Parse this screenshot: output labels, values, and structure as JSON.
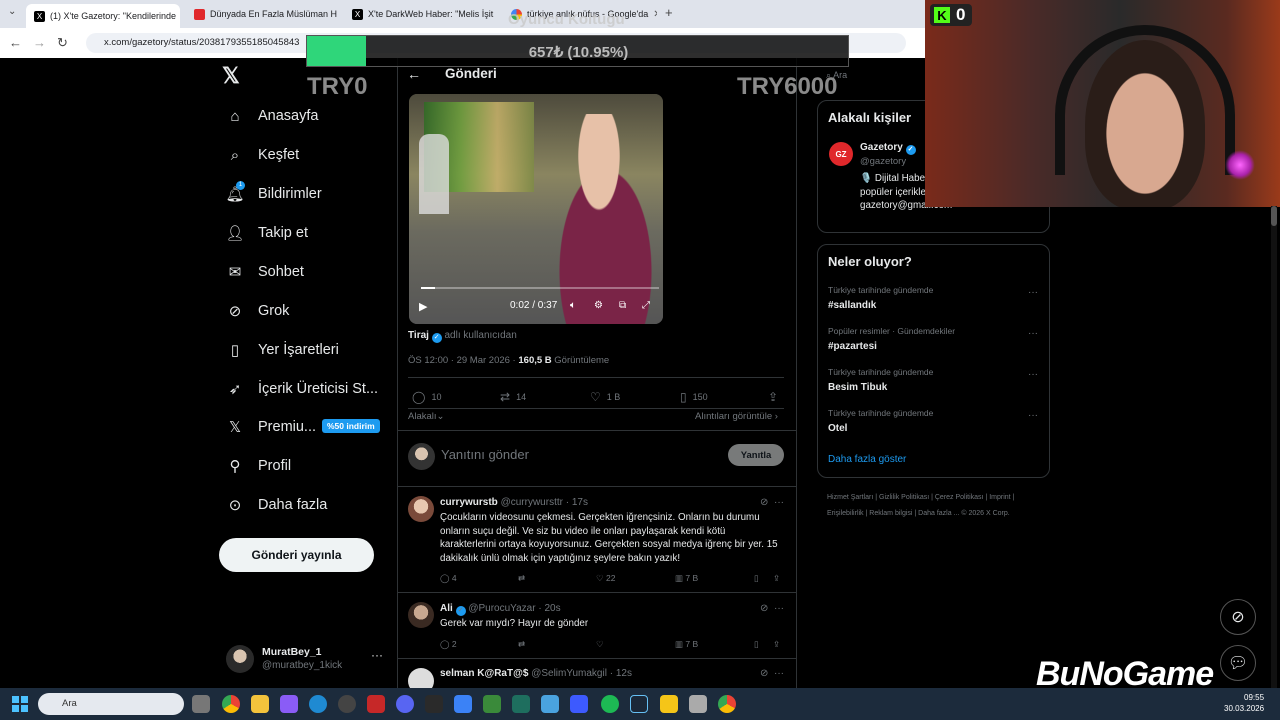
{
  "browser": {
    "tabs": [
      {
        "label": "(1) X'te Gazetory: \"Kendilerinde",
        "icon": "x-favicon",
        "active": true
      },
      {
        "label": "Dünyada En Fazla Müslüman H",
        "icon": "red-favicon",
        "active": false
      },
      {
        "label": "X'te DarkWeb Haber: \"Melis İşit",
        "icon": "x-favicon",
        "active": false
      },
      {
        "label": "türkiye anlık nüfus - Google'da",
        "icon": "google-favicon",
        "active": false
      }
    ],
    "url": "x.com/gazetory/status/2038179355185045843"
  },
  "overlay": {
    "title": "Oyuncu Koltuğu",
    "progress_text": "657₺ (10.95%)",
    "progress": 0.1095,
    "left_label": "TRY0",
    "right_label": "TRY6000"
  },
  "nav": {
    "items": [
      {
        "label": "Anasayfa",
        "icon": "home-icon"
      },
      {
        "label": "Keşfet",
        "icon": "search-icon"
      },
      {
        "label": "Bildirimler",
        "icon": "bell-icon"
      },
      {
        "label": "Takip et",
        "icon": "follow-icon"
      },
      {
        "label": "Sohbet",
        "icon": "mail-icon"
      },
      {
        "label": "Grok",
        "icon": "grok-icon"
      },
      {
        "label": "Yer İşaretleri",
        "icon": "bookmark-icon"
      },
      {
        "label": "İçerik Üreticisi St...",
        "icon": "rocket-icon"
      },
      {
        "label": "Premiu...",
        "icon": "x-icon"
      },
      {
        "label": "Profil",
        "icon": "person-icon"
      },
      {
        "label": "Daha fazla",
        "icon": "more-circle-icon"
      }
    ],
    "notification_badge": "1",
    "premium_badge": "%50 indirim",
    "post_button": "Gönderi yayınla",
    "account_name": "MuratBey_1",
    "account_handle": "@muratbey_1kick"
  },
  "main": {
    "title": "Gönderi",
    "video_time": "0:02 / 0:37",
    "author_name": "Tiraj",
    "author_sub": "adlı kullanıcıdan",
    "meta_time": "ÖS 12:00 · 29 Mar 2026 · ",
    "meta_views": "160,5 B",
    "meta_views_label": " Görüntüleme",
    "stats": {
      "replies": "10",
      "reposts": "14",
      "likes": "1 B",
      "bookmarks": "150"
    },
    "sort_label": "Alakalı",
    "quotes_label": "Alıntıları görüntüle",
    "reply_placeholder": "Yanıtını gönder",
    "reply_button": "Yanıtla",
    "replies": [
      {
        "name": "currywurstb",
        "handle": "@currywursttr · 17s",
        "text": "Çocukların videosunu çekmesi. Gerçekten iğrençsiniz. Onların bu durumu onların suçu değil. Ve siz bu video ile onları paylaşarak kendi kötü karakterlerini ortaya koyuyorsunuz. Gerçekten sosyal medya iğrenç bir yer. 15 dakikalık ünlü olmak için yaptığınız şeylere bakın yazık!",
        "replies": "4",
        "reposts": "",
        "likes": "22",
        "views": "7 B"
      },
      {
        "name": "Ali",
        "handle": "@PurocuYazar · 20s",
        "text": "Gerek var mıydı? Hayır de gönder",
        "replies": "2",
        "reposts": "",
        "likes": "",
        "views": "7 B"
      },
      {
        "name": "selman K@RaT@$",
        "handle": "@SelimYumakgil · 12s",
        "text": "",
        "replies": "",
        "reposts": "",
        "likes": "",
        "views": ""
      }
    ]
  },
  "sidebar": {
    "search_placeholder": "Ara",
    "people_title": "Alakalı kişiler",
    "person_name": "Gazetory",
    "person_handle": "@gazetory",
    "person_bio": "🎙️ Dijital Habe Gazetory dijita haber ve popüler içerikleri sizlere paylaşır. | gazetory@gmail.com",
    "trends_title": "Neler oluyor?",
    "trends": [
      {
        "context": "Türkiye tarihinde gündemde",
        "topic": "#sallandık"
      },
      {
        "context": "Popüler resimler · Gündemdekiler",
        "topic": "#pazartesi"
      },
      {
        "context": "Türkiye tarihinde gündemde",
        "topic": "Besim Tibuk"
      },
      {
        "context": "Türkiye tarihinde gündemde",
        "topic": "Otel"
      }
    ],
    "show_more": "Daha fazla göster",
    "footer": "Hizmet Şartları | Gizlilik Politikası | Çerez Politikası | Imprint | Erişilebilirlik | Reklam bilgisi | Daha fazla ... © 2026 X Corp."
  },
  "stream": {
    "kick_count": "0",
    "brand": "BuNoGame"
  },
  "taskbar": {
    "search_placeholder": "Ara",
    "time": "09:55",
    "date": "30.03.2026"
  },
  "colors": {
    "accent": "#1d9bf0",
    "background": "#000000",
    "progress_fill": "#2fd67a",
    "kick_green": "#53fc18"
  }
}
